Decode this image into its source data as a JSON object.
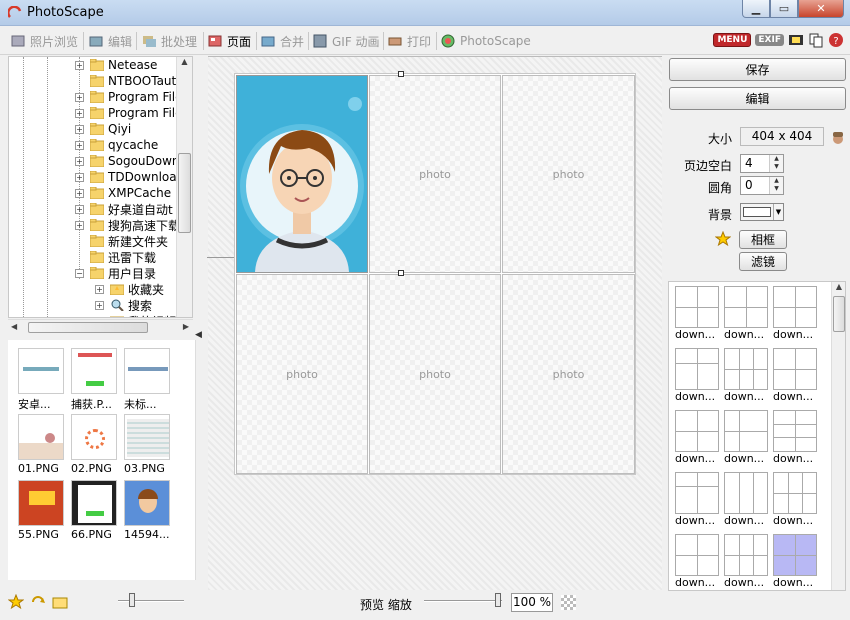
{
  "window": {
    "title": "PhotoScape"
  },
  "tabs": [
    {
      "label": "照片浏览",
      "active": false
    },
    {
      "label": "编辑",
      "active": false
    },
    {
      "label": "批处理",
      "active": false
    },
    {
      "label": "页面",
      "active": true
    },
    {
      "label": "合并",
      "active": false
    },
    {
      "label": "GIF 动画",
      "active": false
    },
    {
      "label": "打印",
      "active": false
    },
    {
      "label": "PhotoScape",
      "active": false
    }
  ],
  "toolbar_right": {
    "menu": "MENU",
    "exif": "EXIF"
  },
  "tree": {
    "items": [
      {
        "label": "Netease",
        "expander": "+"
      },
      {
        "label": "NTBOOTaut",
        "expander": ""
      },
      {
        "label": "Program File",
        "expander": "+"
      },
      {
        "label": "Program File",
        "expander": "+"
      },
      {
        "label": "Qiyi",
        "expander": "+"
      },
      {
        "label": "qycache",
        "expander": "+"
      },
      {
        "label": "SogouDown",
        "expander": "+"
      },
      {
        "label": "TDDownloa",
        "expander": "+"
      },
      {
        "label": "XMPCache",
        "expander": "+"
      },
      {
        "label": "好桌道自动t",
        "expander": "+"
      },
      {
        "label": "搜狗高速下载",
        "expander": "+"
      },
      {
        "label": "新建文件夹",
        "expander": ""
      },
      {
        "label": "迅雷下载",
        "expander": ""
      },
      {
        "label": "用户目录",
        "expander": "−"
      }
    ],
    "sub_items": [
      {
        "label": "收藏夹",
        "expander": "+"
      },
      {
        "label": "搜索",
        "expander": "+"
      },
      {
        "label": "我的视频",
        "expander": ""
      }
    ]
  },
  "thumbnails": [
    {
      "label": "安卓..."
    },
    {
      "label": "捕获.P..."
    },
    {
      "label": "未标..."
    },
    {
      "label": "01.PNG"
    },
    {
      "label": "02.PNG"
    },
    {
      "label": "03.PNG"
    },
    {
      "label": "55.PNG"
    },
    {
      "label": "66.PNG"
    },
    {
      "label": "14594..."
    }
  ],
  "canvas": {
    "cells": [
      "",
      "photo",
      "photo",
      "photo",
      "photo",
      "photo"
    ]
  },
  "bottom": {
    "preview_label": "预览 缩放",
    "zoom": "100 %"
  },
  "right": {
    "save": "保存",
    "edit": "编辑",
    "size_label": "大小",
    "size_value": "404 x 404",
    "margin_label": "页边空白",
    "margin_value": "4",
    "radius_label": "圆角",
    "radius_value": "0",
    "bg_label": "背景",
    "frame_btn": "相框",
    "filter_btn": "滤镜"
  },
  "templates": {
    "labels": [
      "down...",
      "down...",
      "down...",
      "down...",
      "down...",
      "down...",
      "down...",
      "down...",
      "down...",
      "down...",
      "down...",
      "down...",
      "down...",
      "down...",
      "down..."
    ]
  },
  "colors": {
    "accent_photo": "#3fb1d9",
    "menu_red": "#c0282b",
    "template_selected": "#b8b8f4"
  }
}
